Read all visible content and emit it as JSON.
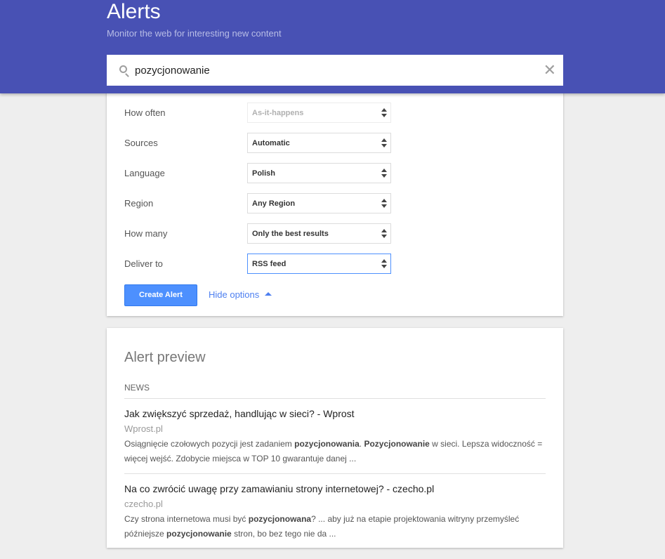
{
  "header": {
    "title": "Alerts",
    "subtitle": "Monitor the web for interesting new content",
    "color": "#4851b4"
  },
  "search": {
    "value": "pozycjonowanie",
    "icon": "search-icon",
    "clear_icon": "close-icon",
    "clear_label": "✕"
  },
  "options": [
    {
      "label": "How often",
      "value": "As-it-happens",
      "state": "disabled"
    },
    {
      "label": "Sources",
      "value": "Automatic",
      "state": "normal"
    },
    {
      "label": "Language",
      "value": "Polish",
      "state": "normal"
    },
    {
      "label": "Region",
      "value": "Any Region",
      "state": "normal"
    },
    {
      "label": "How many",
      "value": "Only the best results",
      "state": "normal"
    },
    {
      "label": "Deliver to",
      "value": "RSS feed",
      "state": "focused"
    }
  ],
  "actions": {
    "create_label": "Create Alert",
    "hide_options_label": "Hide options",
    "accent": "#4d90fe"
  },
  "preview": {
    "title": "Alert preview",
    "section": "NEWS",
    "items": [
      {
        "title": "Jak zwiększyć sprzedaż, handlując w sieci? - Wprost",
        "source": "Wprost.pl",
        "snippet": [
          {
            "text": "Osiągnięcie czołowych pozycji jest zadaniem ",
            "bold": false
          },
          {
            "text": "pozycjonowania",
            "bold": true
          },
          {
            "text": ". ",
            "bold": false
          },
          {
            "text": "Pozycjonowanie",
            "bold": true
          },
          {
            "text": " w sieci. Lepsza widoczność = więcej wejść. Zdobycie miejsca w TOP 10 gwarantuje danej ...",
            "bold": false
          }
        ]
      },
      {
        "title": "Na co zwrócić uwagę przy zamawianiu strony internetowej? - czecho.pl",
        "source": "czecho.pl",
        "snippet": [
          {
            "text": "Czy strona internetowa musi być ",
            "bold": false
          },
          {
            "text": "pozycjonowana",
            "bold": true
          },
          {
            "text": "? ... aby już na etapie projektowania witryny przemyśleć późniejsze ",
            "bold": false
          },
          {
            "text": "pozycjonowanie",
            "bold": true
          },
          {
            "text": " stron, bo bez tego nie da ...",
            "bold": false
          }
        ]
      }
    ]
  }
}
